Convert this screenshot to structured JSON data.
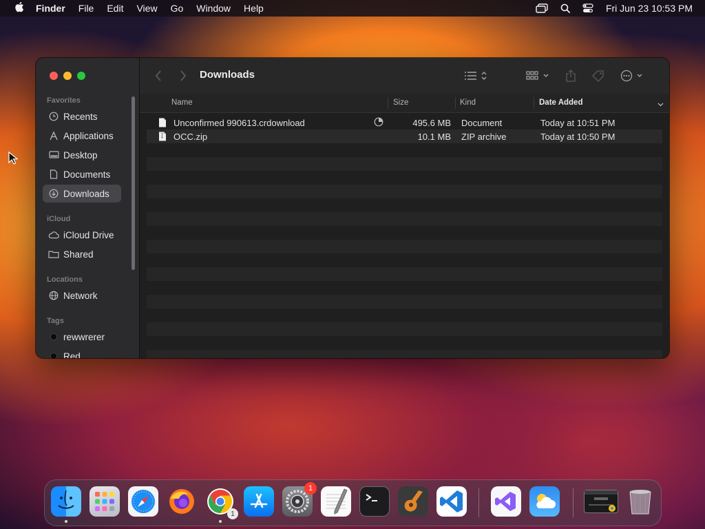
{
  "menubar": {
    "app_name": "Finder",
    "items": [
      "File",
      "Edit",
      "View",
      "Go",
      "Window",
      "Help"
    ],
    "datetime": "Fri Jun 23  10:53 PM"
  },
  "sidebar": {
    "sections": [
      {
        "title": "Favorites",
        "items": [
          {
            "label": "Recents",
            "icon": "clock-icon"
          },
          {
            "label": "Applications",
            "icon": "applications-icon"
          },
          {
            "label": "Desktop",
            "icon": "desktop-icon"
          },
          {
            "label": "Documents",
            "icon": "document-icon"
          },
          {
            "label": "Downloads",
            "icon": "download-icon",
            "active": true
          }
        ]
      },
      {
        "title": "iCloud",
        "items": [
          {
            "label": "iCloud Drive",
            "icon": "cloud-icon"
          },
          {
            "label": "Shared",
            "icon": "shared-folder-icon"
          }
        ]
      },
      {
        "title": "Locations",
        "items": [
          {
            "label": "Network",
            "icon": "globe-icon"
          }
        ]
      },
      {
        "title": "Tags",
        "items": [
          {
            "label": "rewwrerer",
            "icon": "tag-dot-icon"
          },
          {
            "label": "Red",
            "icon": "tag-dot-icon"
          }
        ]
      }
    ]
  },
  "toolbar": {
    "title": "Downloads"
  },
  "columns": {
    "name": "Name",
    "size": "Size",
    "kind": "Kind",
    "date_added": "Date Added"
  },
  "files": [
    {
      "name": "Unconfirmed 990613.crdownload",
      "size": "495.6 MB",
      "kind": "Document",
      "date_added": "Today at 10:51 PM",
      "downloading": true
    },
    {
      "name": "OCC.zip",
      "size": "10.1 MB",
      "kind": "ZIP archive",
      "date_added": "Today at 10:50 PM"
    }
  ],
  "dock": {
    "settings_badge": "1",
    "chrome_badge": "1",
    "icons": [
      "finder",
      "launchpad",
      "safari",
      "firefox",
      "chrome",
      "app-store",
      "system-settings",
      "textedit",
      "terminal",
      "garageband",
      "vscode",
      "visual-studio",
      "weather",
      "chrome-window",
      "trash"
    ]
  },
  "colors": {
    "accent_blue": "#0a84ff",
    "traffic_close": "#ff5f57",
    "traffic_min": "#febc2e",
    "traffic_max": "#28c840"
  }
}
